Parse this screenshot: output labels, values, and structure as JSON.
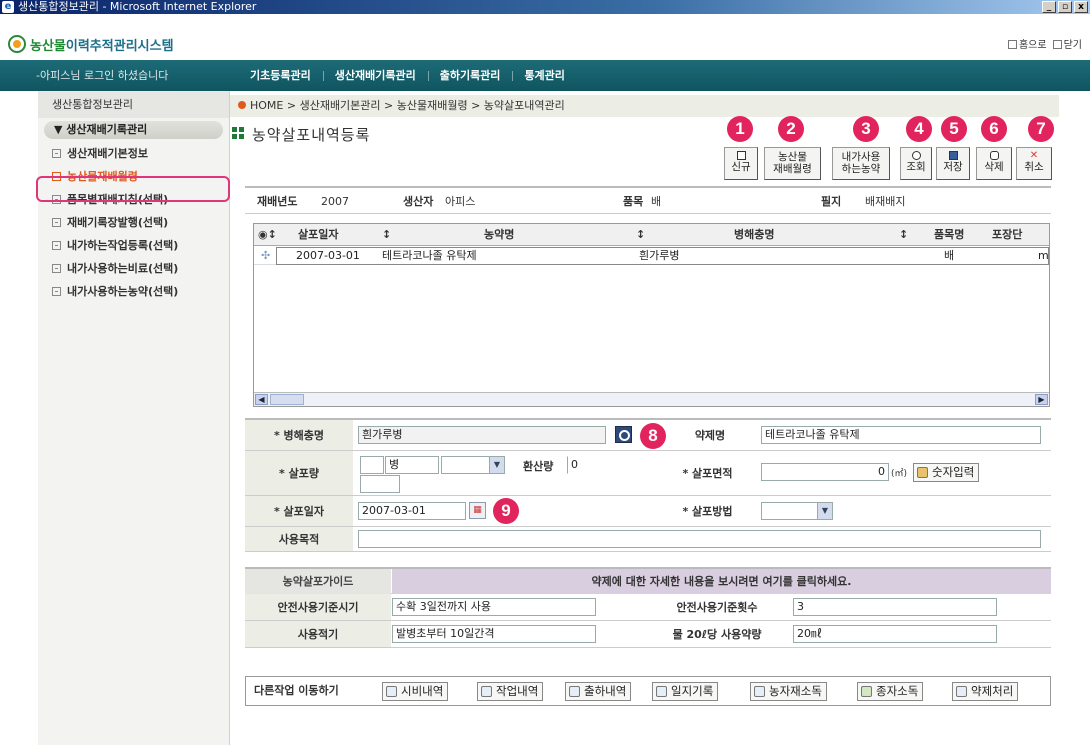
{
  "window": {
    "title": "생산통합정보관리 - Microsoft Internet Explorer",
    "btn_min": "_",
    "btn_max": "▫",
    "btn_close": "x"
  },
  "header": {
    "logo_green": "농산물",
    "logo_dark": "이력추적관리시스템",
    "home_link": "홈으로",
    "close_link": "닫기"
  },
  "nav": {
    "welcome": "-아피스님 로그인 하셨습니다",
    "menu": [
      "기초등록관리",
      "생산재배기록관리",
      "출하기록관리",
      "통계관리"
    ]
  },
  "sidebar": {
    "title": "생산통합정보관리",
    "section": "생산재배기록관리",
    "items": [
      "생산재배기본정보",
      "농산물재배월령",
      "품목별재배지침(선택)",
      "재배기록장발행(선택)",
      "내가하는작업등록(선택)",
      "내가사용하는비료(선택)",
      "내가사용하는농약(선택)"
    ]
  },
  "breadcrumb": "HOME > 생산재배기본관리 > 농산물재배월령 > 농약살포내역관리",
  "page_title": "농약살포내역등록",
  "callouts": [
    "1",
    "2",
    "3",
    "4",
    "5",
    "6",
    "7",
    "8",
    "9"
  ],
  "toolbar": {
    "new": "신규",
    "crop_month_1": "농산물",
    "crop_month_2": "재배월령",
    "my_pest_1": "내가사용",
    "my_pest_2": "하는농약",
    "search": "조회",
    "save": "저장",
    "delete": "삭제",
    "cancel": "취소"
  },
  "info": {
    "year_label": "재배년도",
    "year": "2007",
    "producer_label": "생산자",
    "producer": "아피스",
    "item_label": "품목",
    "item": "배",
    "field_label": "필지",
    "field": "배재배지"
  },
  "grid": {
    "headers": [
      "◉↕",
      "살포일자",
      "↕",
      "농약명",
      "↕",
      "병해충명",
      "↕",
      "품목명",
      "포장단"
    ],
    "row": {
      "marker": "✣",
      "date": "2007-03-01",
      "pesticide": "테트라코나졸 유탁제",
      "disease": "흰가루병",
      "item": "배",
      "unit": "m"
    },
    "scroll_left": "◀",
    "scroll_right": "▶"
  },
  "form": {
    "disease_label": "* 병해충명",
    "disease_value": "흰가루병",
    "agent_label": "약제명",
    "agent_value": "테트라코나졸 유탁제",
    "amount_label": "* 살포량",
    "amount_unit": "병",
    "convert_label": "환산량",
    "convert_value": "0",
    "area_label": "* 살포면적",
    "area_value": "0",
    "area_unit": "(㎡)",
    "num_input_btn": "숫자입력",
    "date_label": "* 살포일자",
    "date_value": "2007-03-01",
    "method_label": "* 살포방법",
    "purpose_label": "사용목적"
  },
  "guide": {
    "title": "농약살포가이드",
    "message": "약제에 대한 자세한 내용을 보시려면 여기를 클릭하세요.",
    "safe_time_label": "안전사용기준시기",
    "safe_time": "수확 3일전까지 사용",
    "safe_count_label": "안전사용기준횟수",
    "safe_count": "3",
    "proper_label": "사용적기",
    "proper": "발병초부터 10일간격",
    "dose_label": "물 20ℓ당 사용약량",
    "dose": "20㎖"
  },
  "other_work": {
    "label": "다른작업 이동하기",
    "buttons": [
      "시비내역",
      "작업내역",
      "출하내역",
      "일지기록",
      "농자재소독",
      "종자소독",
      "약제처리"
    ]
  }
}
